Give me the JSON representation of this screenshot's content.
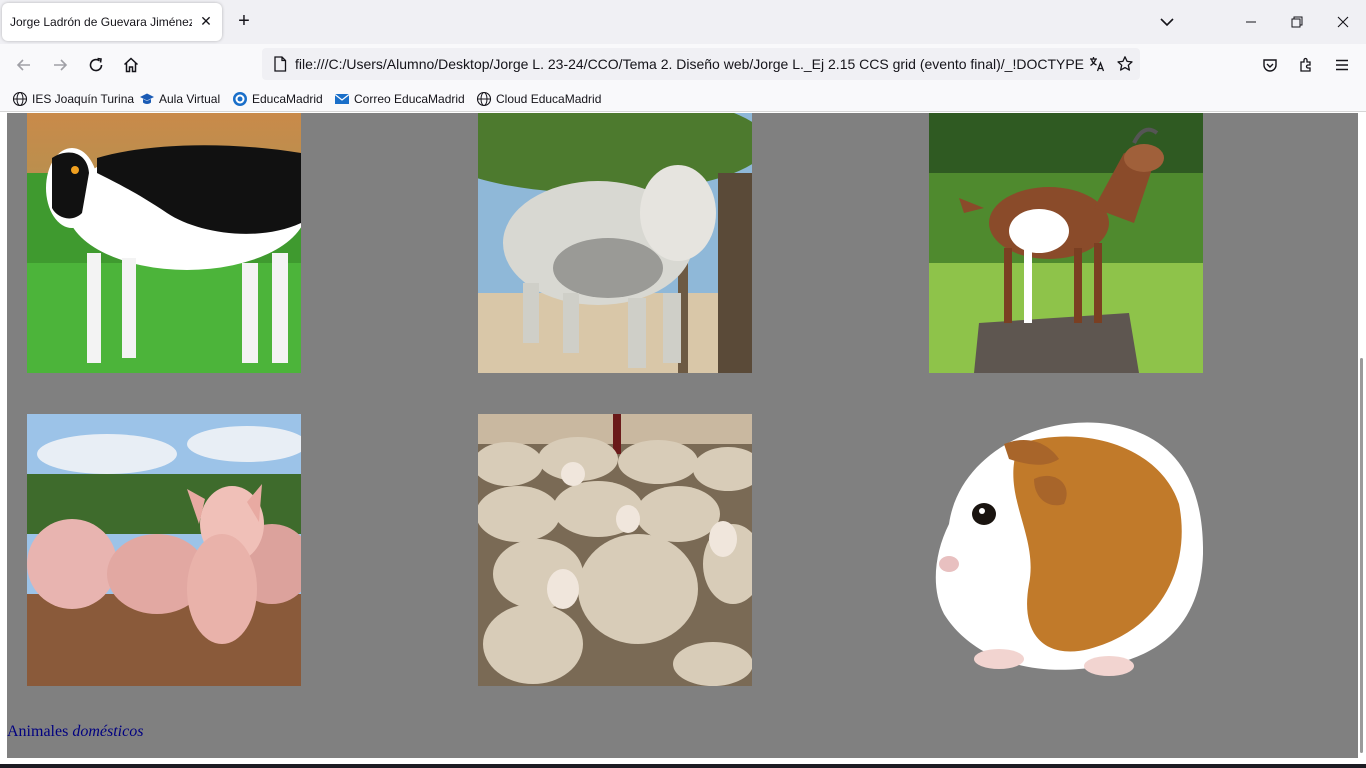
{
  "browser": {
    "tab_title": "Jorge Ladrón de Guevara Jiménez",
    "url": "file:///C:/Users/Alumno/Desktop/Jorge L. 23-24/CCO/Tema 2. Diseño web/Jorge L._Ej 2.15 CCS grid (evento final)/_!DOCTYPE htm",
    "icons": {
      "back": "back-arrow-icon",
      "forward": "forward-arrow-icon",
      "reload": "reload-icon",
      "home": "home-icon",
      "page": "file-page-icon",
      "translate": "translate-icon",
      "bookmark_star": "star-icon",
      "pocket": "pocket-icon",
      "extensions": "extensions-icon",
      "menu": "hamburger-menu-icon"
    }
  },
  "bookmarks": [
    {
      "label": "IES Joaquín Turina",
      "icon": "globe-icon"
    },
    {
      "label": "Aula Virtual",
      "icon": "graduation-cap-icon"
    },
    {
      "label": "EducaMadrid",
      "icon": "educamadrid-icon"
    },
    {
      "label": "Correo EducaMadrid",
      "icon": "mail-icon"
    },
    {
      "label": "Cloud EducaMadrid",
      "icon": "globe-icon"
    }
  ],
  "page": {
    "background": "#808080",
    "caption_text": "Animales ",
    "caption_emphasis": "domésticos",
    "caption_color": "#000080",
    "images": [
      {
        "subject": "cow"
      },
      {
        "subject": "bull"
      },
      {
        "subject": "goat"
      },
      {
        "subject": "pig"
      },
      {
        "subject": "sheep"
      },
      {
        "subject": "guinea-pig"
      }
    ]
  }
}
